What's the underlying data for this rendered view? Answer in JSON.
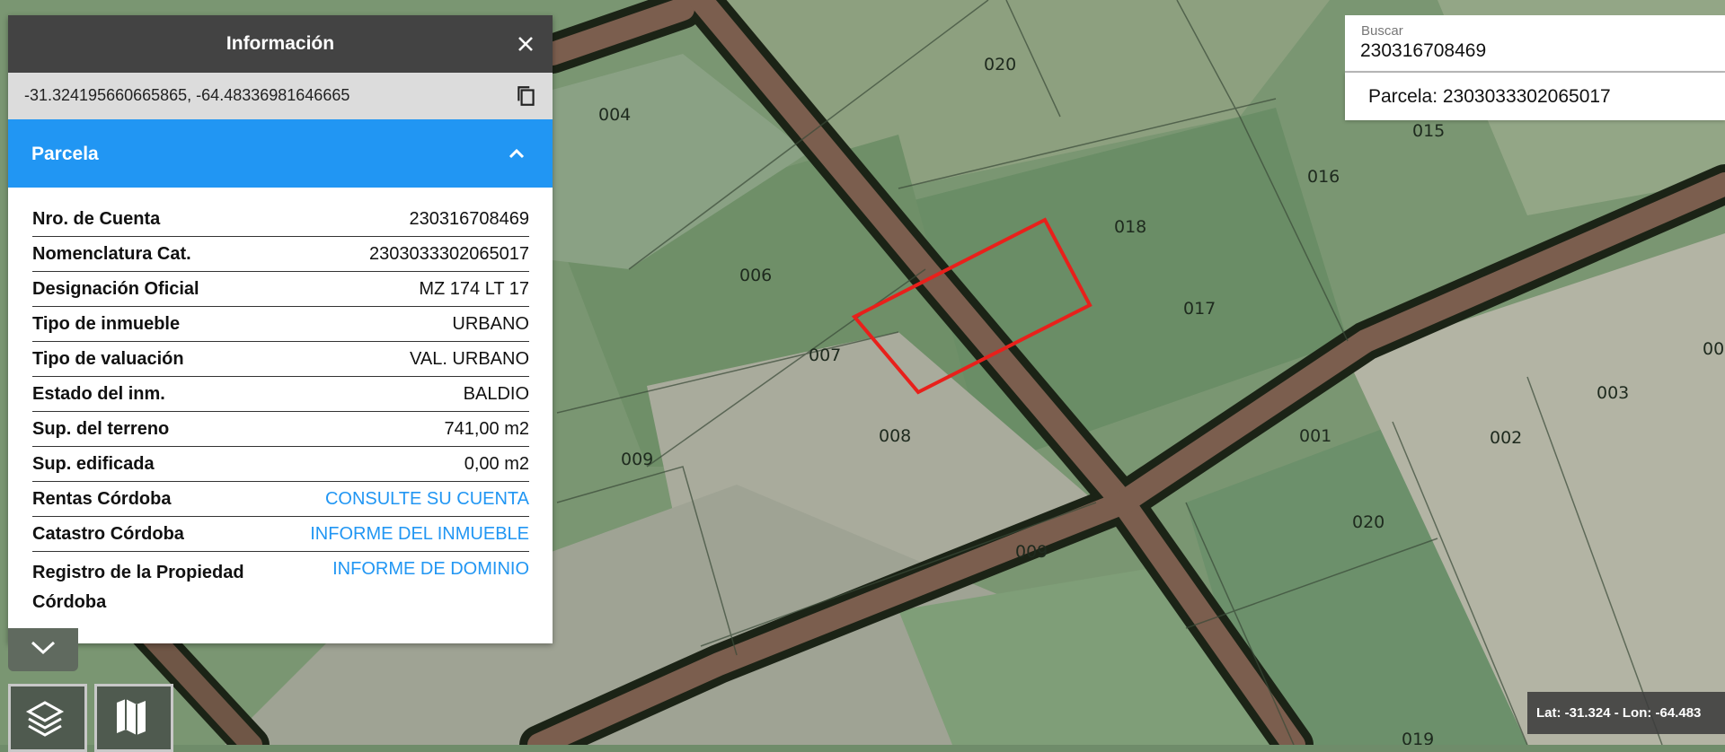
{
  "info_panel": {
    "title": "Información",
    "coordinates": "-31.324195660665865, -64.48336981646665",
    "section_title": "Parcela",
    "rows": [
      {
        "label": "Nro. de Cuenta",
        "value": "230316708469"
      },
      {
        "label": "Nomenclatura Cat.",
        "value": "2303033302065017"
      },
      {
        "label": "Designación Oficial",
        "value": "MZ 174 LT 17"
      },
      {
        "label": "Tipo de inmueble",
        "value": "URBANO"
      },
      {
        "label": "Tipo de valuación",
        "value": "VAL. URBANO"
      },
      {
        "label": "Estado del inm.",
        "value": "BALDIO"
      },
      {
        "label": "Sup. del terreno",
        "value": "741,00 m2"
      },
      {
        "label": "Sup. edificada",
        "value": "0,00 m2"
      },
      {
        "label": "Rentas Córdoba",
        "value": "CONSULTE SU CUENTA"
      },
      {
        "label": "Catastro Córdoba",
        "value": "INFORME DEL INMUEBLE"
      },
      {
        "label": "Registro de la Propiedad Córdoba",
        "value": "INFORME DE DOMINIO"
      }
    ]
  },
  "search": {
    "caption": "Buscar",
    "value": "230316708469",
    "result": "Parcela: 2303033302065017"
  },
  "map": {
    "lot_labels": [
      "020",
      "004",
      "015",
      "016",
      "018",
      "017",
      "006",
      "007",
      "008",
      "009",
      "001",
      "002",
      "003",
      "020",
      "009",
      "019",
      "00"
    ],
    "selected_lot": "017",
    "selection_color": "#e8201b"
  },
  "status": {
    "latlon": "Lat: -31.324 - Lon: -64.483"
  },
  "icons": {
    "close": "close-icon",
    "copy": "copy-icon",
    "collapse": "chevron-up-icon",
    "expand": "chevron-down-icon",
    "layers": "layers-icon",
    "basemap": "map-icon"
  }
}
